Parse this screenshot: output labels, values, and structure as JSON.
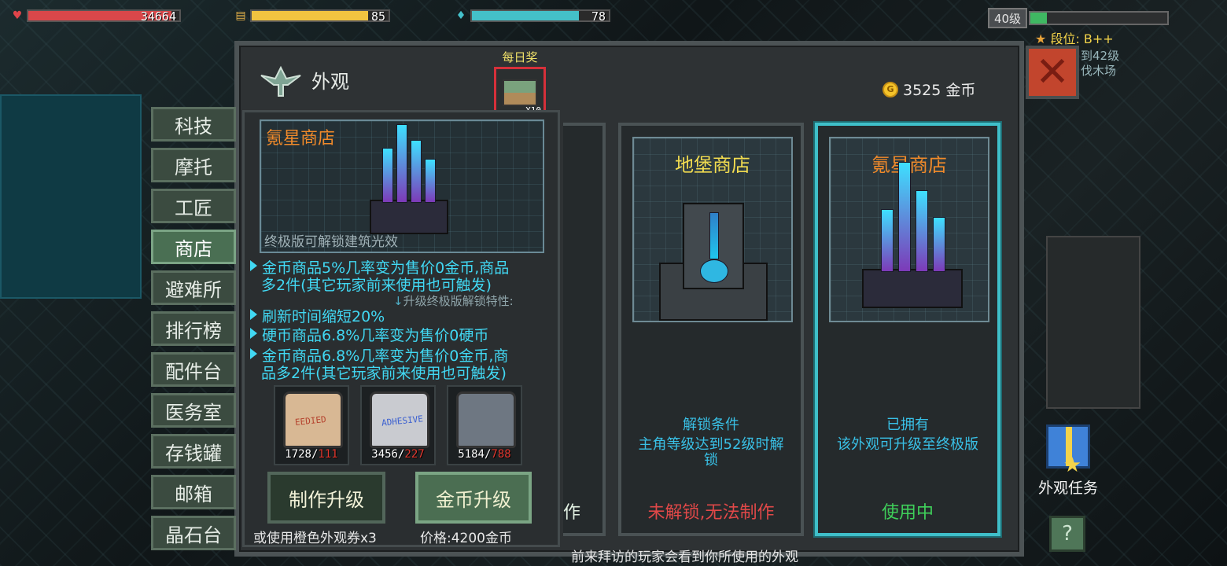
{
  "hud": {
    "health": {
      "value": "34664",
      "fill": 0.95,
      "color": "#d9474a",
      "icon": "heart-icon"
    },
    "food": {
      "value": "85",
      "fill": 0.85,
      "color": "#f1c340",
      "icon": "food-icon"
    },
    "water": {
      "value": "78",
      "fill": 0.78,
      "color": "#44c0c8",
      "icon": "water-drop-icon"
    },
    "level": "40级",
    "level_progress": 0.12,
    "rank": "段位: B++",
    "quest_hint_1": "到42级",
    "quest_hint_2": "伐木场"
  },
  "panel": {
    "title": "外观",
    "coins": "3525 金币",
    "close_icon": "close-icon"
  },
  "daily_reward": {
    "label": "每日奖",
    "count": "X10"
  },
  "tabs": [
    {
      "label": "科技",
      "active": false
    },
    {
      "label": "摩托",
      "active": false
    },
    {
      "label": "工匠",
      "active": false
    },
    {
      "label": "商店",
      "active": true
    },
    {
      "label": "避难所",
      "active": false
    },
    {
      "label": "排行榜",
      "active": false
    },
    {
      "label": "配件台",
      "active": false
    },
    {
      "label": "医务室",
      "active": false
    },
    {
      "label": "存钱罐",
      "active": false
    },
    {
      "label": "邮箱",
      "active": false
    },
    {
      "label": "晶石台",
      "active": false
    }
  ],
  "detail": {
    "name": "氪星商店",
    "preview_note": "终极版可解锁建筑光效",
    "feature_1_line1": "金币商品5%几率变为售价0金币,商品",
    "feature_1_line2": "多2件(其它玩家前来使用也可触发)",
    "upgrade_hint": "升级终极版解锁特性:",
    "feature_2": "刷新时间缩短20%",
    "feature_3": "硬币商品6.8%几率变为售价0硬币",
    "feature_4_line1": "金币商品6.8%几率变为售价0金币,商",
    "feature_4_line2": "品多2件(其它玩家前来使用也可触发)",
    "materials": [
      {
        "have": "1728",
        "need": "111",
        "label": "EEDIED",
        "color": "#d8b894"
      },
      {
        "have": "3456",
        "need": "227",
        "label": "ADHESIVE",
        "color": "#c9cbd0"
      },
      {
        "have": "5184",
        "need": "788",
        "label": "",
        "color": "#6e7782"
      }
    ],
    "craft_button": "制作升级",
    "coin_button": "金币升级",
    "craft_note": "或使用橙色外观券x3",
    "coin_note": "价格:4200金币"
  },
  "cards": {
    "partial_status": "作",
    "bunker": {
      "name": "地堡商店",
      "cond_title": "解锁条件",
      "cond_line1": "主角等级达到52级时解",
      "cond_line2": "锁",
      "status": "未解锁,无法制作",
      "name_color": "#f3dd50",
      "status_color": "#e04848"
    },
    "krypton": {
      "name": "氪星商店",
      "cond_title": "已拥有",
      "cond_line1": "该外观可升级至终极版",
      "status": "使用中",
      "name_color": "#f08a2a",
      "status_color": "#3fcf5a"
    }
  },
  "skin_task": {
    "label": "外观任务"
  },
  "help": "?",
  "footer": "前来拜访的玩家会看到你所使用的外观"
}
